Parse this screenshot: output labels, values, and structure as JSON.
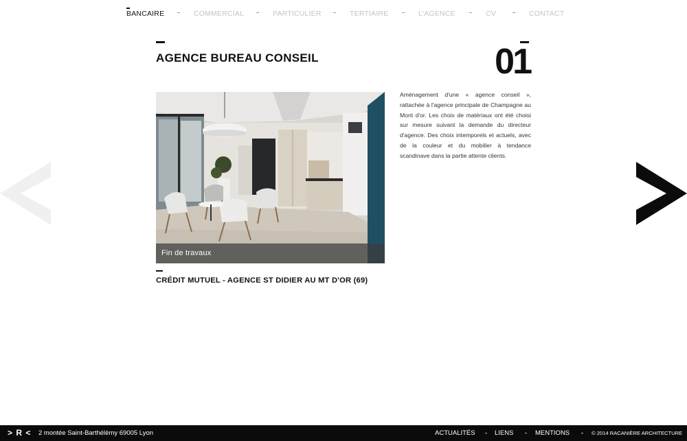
{
  "nav": {
    "items": [
      {
        "label": "BANCAIRE",
        "active": true
      },
      {
        "label": "COMMERCIAL",
        "active": false
      },
      {
        "label": "PARTICULIER",
        "active": false
      },
      {
        "label": "TERTIAIRE",
        "active": false
      },
      {
        "label": "L'AGENCE",
        "active": false
      },
      {
        "label": "CV",
        "active": false
      },
      {
        "label": "CONTACT",
        "active": false
      }
    ]
  },
  "project": {
    "title": "AGENCE BUREAU CONSEIL",
    "number": "01",
    "caption": "Fin de travaux",
    "description": "Aménagement d'une « agence conseil », rattachée à l'agence principale de Champagne au Mont d'or.  Les choix de matériaux ont été choisi sur mesure suivant la demande du directeur d'agence. Des choix intemporels et actuels, avec de la couleur et du mobilier à tendance scandinave dans la partie attente clients.",
    "client": "CRÉDIT MUTUEL - AGENCE ST DIDIER AU MT D'OR (69)"
  },
  "arrows": {
    "prev_icon": "chevron-left-icon",
    "next_icon": "chevron-right-icon",
    "prev_color": "#f0f0f0",
    "next_color": "#0b0b0b"
  },
  "footer": {
    "logo": "> R <",
    "address": "2 montée Saint-Barthélémy 69005 Lyon",
    "links": [
      "ACTUALITÉS",
      "LIENS",
      "MENTIONS"
    ],
    "copyright": "© 2014 RACANIÈRE ARCHITECTURE"
  }
}
